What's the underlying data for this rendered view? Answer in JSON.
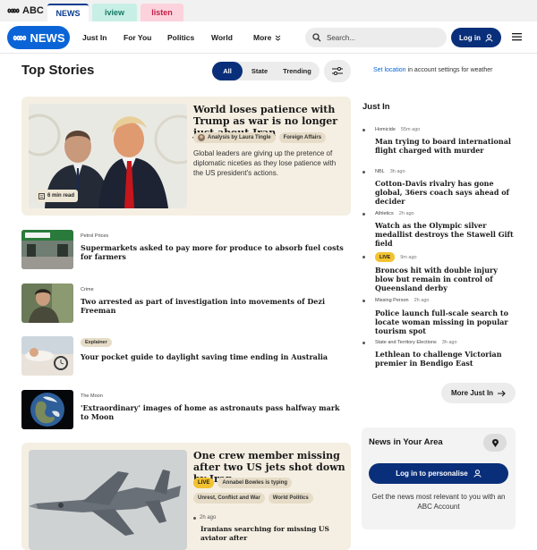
{
  "network": {
    "brand": "ABC",
    "tabs": [
      {
        "label": "NEWS",
        "active": true
      },
      {
        "label": "iview",
        "active": false
      },
      {
        "label": "listen",
        "active": false
      }
    ]
  },
  "header": {
    "logo_text": "NEWS",
    "nav": [
      "Just In",
      "For You",
      "Politics",
      "World",
      "More"
    ],
    "search_placeholder": "Search...",
    "login_label": "Log in"
  },
  "top_stories": {
    "title": "Top Stories",
    "filters": [
      {
        "label": "All",
        "selected": true
      },
      {
        "label": "State",
        "selected": false
      },
      {
        "label": "Trending",
        "selected": false
      }
    ],
    "weather_link": "Set location",
    "weather_text": " in account settings for weather"
  },
  "hero": {
    "title": "World loses patience with Trump as war is no longer just about Iran",
    "byline": "Analysis by Laura Tingle",
    "section": "Foreign Affairs",
    "description": "Global leaders are giving up the pretence of diplomatic niceties as they lose patience with the US president's actions.",
    "read_time": "6 min read"
  },
  "stories": [
    {
      "category": "Petrol Prices",
      "title": "Supermarkets asked to pay more for produce to absorb fuel costs for farmers"
    },
    {
      "category": "Crime",
      "title": "Two arrested as part of investigation into movements of Dezi Freeman"
    },
    {
      "category": "Explainer",
      "title": "Your pocket guide to daylight saving time ending in Australia"
    },
    {
      "category": "The Moon",
      "title": "'Extraordinary' images of home as astronauts pass halfway mark to Moon"
    }
  ],
  "hero2": {
    "title": "One crew member missing after two US jets shot down by Iran",
    "live_label": "LIVE",
    "byline": "Annabel Bowles is typing",
    "tags": [
      "Unrest, Conflict and War",
      "World Politics"
    ],
    "time": "2h ago",
    "sub": "Iranians searching for missing US aviator after"
  },
  "just_in": {
    "title": "Just In",
    "items": [
      {
        "category": "Homicide",
        "time": "55m ago",
        "live": false,
        "headline": "Man trying to board international flight charged with murder"
      },
      {
        "category": "NBL",
        "time": "3h ago",
        "live": false,
        "headline": "Cotton-Davis rivalry has gone global, 36ers coach says ahead of decider"
      },
      {
        "category": "Athletics",
        "time": "2h ago",
        "live": false,
        "headline": "Watch as the Olympic silver medallist destroys the Stawell Gift field"
      },
      {
        "category": "LIVE",
        "time": "9m ago",
        "live": true,
        "headline": "Broncos hit with double injury blow but remain in control of Queensland derby"
      },
      {
        "category": "Missing Person",
        "time": "2h ago",
        "live": false,
        "headline": "Police launch full-scale search to locate woman missing in popular tourism spot"
      },
      {
        "category": "State and Territory Elections",
        "time": "3h ago",
        "live": false,
        "headline": "Lethlean to challenge Victorian premier in Bendigo East"
      }
    ],
    "more_label": "More Just In"
  },
  "area": {
    "title": "News in Your Area",
    "login_label": "Log in to personalise",
    "description": "Get the news most relevant to you with an ABC Account"
  },
  "colors": {
    "brand_blue": "#0a64d7",
    "navy": "#0a2f7a",
    "cream": "#f5efe3",
    "live_yellow": "#f2c230"
  }
}
